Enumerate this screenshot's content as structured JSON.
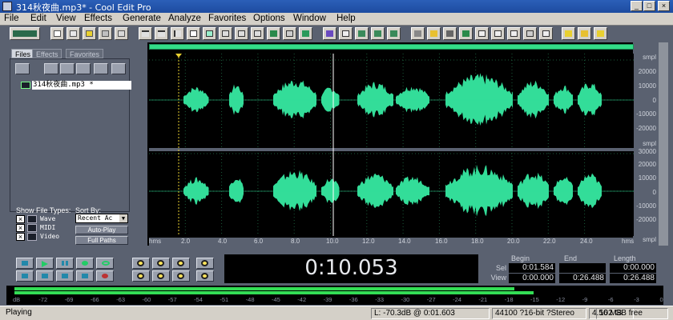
{
  "window": {
    "title": "314秋夜曲.mp3* - Cool Edit Pro",
    "controls": [
      "minimize",
      "maximize",
      "close"
    ]
  },
  "menu": [
    "File",
    "Edit",
    "View",
    "Effects",
    "Generate",
    "Analyze",
    "Favorites",
    "Options",
    "Window",
    "Help"
  ],
  "toolbar": {
    "icons": [
      "edit-mode-icon",
      "new-icon",
      "open-icon",
      "save-icon",
      "close-file-icon",
      "print-icon",
      "undo-icon",
      "redo-icon",
      "cut-icon",
      "copy-icon",
      "paste-icon",
      "mix-paste-icon",
      "delete-icon",
      "trim-icon",
      "mark-icon",
      "snapshot-icon",
      "export-icon",
      "spectral-icon",
      "envelope-icon",
      "grid-icon",
      "cue-list-icon",
      "play-list-icon",
      "info-icon",
      "settings-icon",
      "scope-icon",
      "frequency-icon",
      "time-icon",
      "level-icon",
      "cd-icon",
      "favorites-icon",
      "help-icon"
    ]
  },
  "left_panel": {
    "tabs": [
      "Files",
      "Effects",
      "Favorites"
    ],
    "active_tab": "Files",
    "files": [
      "314秋夜曲.mp3 *"
    ],
    "show_file_types_label": "Show File Types:",
    "file_types": [
      {
        "label": "Wave",
        "checked": true
      },
      {
        "label": "MIDI",
        "checked": true
      },
      {
        "label": "Video",
        "checked": true
      }
    ],
    "sort_by_label": "Sort By:",
    "sort_by_value": "Recent Ac",
    "auto_play_label": "Auto-Play",
    "full_paths_label": "Full Paths"
  },
  "waveform": {
    "amp_scale_top": [
      "smpl",
      "20000",
      "10000",
      "0",
      "-10000",
      "-20000",
      "smpl"
    ],
    "amp_scale_bottom": [
      "30000",
      "20000",
      "10000",
      "0",
      "-10000",
      "-20000",
      "smpl"
    ],
    "time_ruler": [
      "hms",
      "2.0",
      "4.0",
      "6.0",
      "8.0",
      "10.0",
      "12.0",
      "14.0",
      "16.0",
      "18.0",
      "20.0",
      "22.0",
      "24.0",
      "hms"
    ],
    "waveform_color": "#33dd99",
    "grid_color": "#1a5a3a"
  },
  "transport": {
    "time_display": "0:10.053",
    "buttons": [
      "stop-icon",
      "play-icon",
      "pause-icon",
      "play-to-end-icon",
      "loop-icon",
      "go-to-start-icon",
      "rewind-icon",
      "fast-forward-icon",
      "go-to-end-icon",
      "record-icon"
    ],
    "zoom_buttons": [
      "zoom-in-icon",
      "zoom-out-icon",
      "zoom-full-icon",
      "zoom-in-vertical-icon",
      "zoom-out-vertical-icon",
      "zoom-selection-icon",
      "zoom-left-icon",
      "zoom-right-icon"
    ]
  },
  "selection": {
    "headers": {
      "begin": "Begin",
      "end": "End",
      "length": "Length"
    },
    "sel_label": "Sel",
    "view_label": "View",
    "sel": {
      "begin": "0:01.584",
      "end": "",
      "length": "0:00.000"
    },
    "view": {
      "begin": "0:00.000",
      "end": "0:26.488",
      "length": "0:26.488"
    }
  },
  "meter": {
    "scale": [
      "dB",
      "-72",
      "-69",
      "-66",
      "-63",
      "-60",
      "-57",
      "-54",
      "-51",
      "-48",
      "-45",
      "-42",
      "-39",
      "-36",
      "-33",
      "-30",
      "-27",
      "-24",
      "-21",
      "-18",
      "-15",
      "-12",
      "-9",
      "-6",
      "-3",
      "0"
    ],
    "left_level_pct": 78,
    "right_level_pct": 81
  },
  "status": {
    "state": "Playing",
    "level": "L: -70.3dB @  0:01.603",
    "format": "44100 ?16-bit ?Stereo",
    "file_size": "4.56 MB",
    "free_space": "102 GB free"
  }
}
